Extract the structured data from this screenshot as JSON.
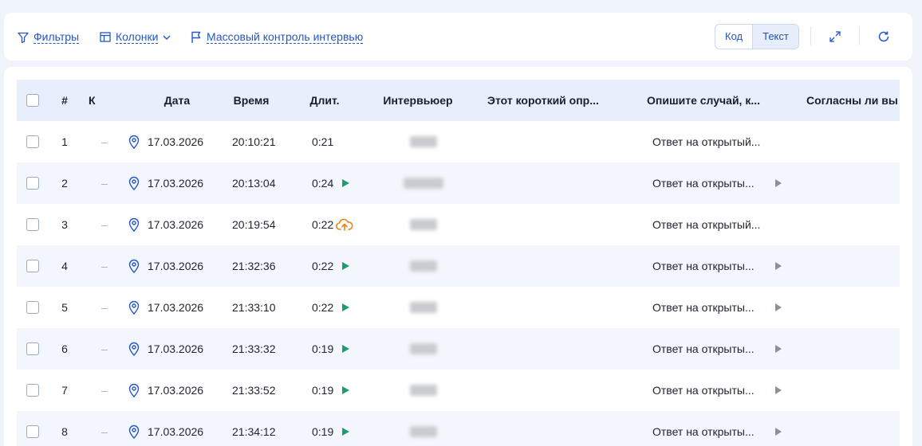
{
  "toolbar": {
    "filters_label": "Фильтры",
    "columns_label": "Колонки",
    "mass_control_label": "Массовый контроль интервью",
    "view_toggle": {
      "code_label": "Код",
      "text_label": "Текст",
      "active": "text"
    }
  },
  "colors": {
    "accent": "#2556c4",
    "play": "#1e9e6a",
    "upload": "#f0820f",
    "header_bg": "#e8effc",
    "alt_row_bg": "#f3f7fd"
  },
  "table": {
    "headers": {
      "num": "#",
      "k": "К",
      "date": "Дата",
      "time": "Время",
      "duration": "Длит.",
      "interviewer": "Интервьюер",
      "q1": "Этот короткий опр...",
      "q2": "Опишите случай, к...",
      "q3": "Согласны ли вы"
    },
    "rows": [
      {
        "num": "1",
        "k": "–",
        "date": "17.03.2026",
        "time": "20:10:21",
        "duration": "0:21",
        "media": "none",
        "answer": "Ответ на открытый..."
      },
      {
        "num": "2",
        "k": "–",
        "date": "17.03.2026",
        "time": "20:13:04",
        "duration": "0:24",
        "media": "play",
        "answer": "Ответ на открыты..."
      },
      {
        "num": "3",
        "k": "–",
        "date": "17.03.2026",
        "time": "20:19:54",
        "duration": "0:22",
        "media": "upload",
        "answer": "Ответ на открытый..."
      },
      {
        "num": "4",
        "k": "–",
        "date": "17.03.2026",
        "time": "21:32:36",
        "duration": "0:22",
        "media": "play",
        "answer": "Ответ на открыты..."
      },
      {
        "num": "5",
        "k": "–",
        "date": "17.03.2026",
        "time": "21:33:10",
        "duration": "0:22",
        "media": "play",
        "answer": "Ответ на открыты..."
      },
      {
        "num": "6",
        "k": "–",
        "date": "17.03.2026",
        "time": "21:33:32",
        "duration": "0:19",
        "media": "play",
        "answer": "Ответ на открыты..."
      },
      {
        "num": "7",
        "k": "–",
        "date": "17.03.2026",
        "time": "21:33:52",
        "duration": "0:19",
        "media": "play",
        "answer": "Ответ на открыты..."
      },
      {
        "num": "8",
        "k": "–",
        "date": "17.03.2026",
        "time": "21:34:12",
        "duration": "0:19",
        "media": "play",
        "answer": "Ответ на открыты..."
      }
    ]
  }
}
